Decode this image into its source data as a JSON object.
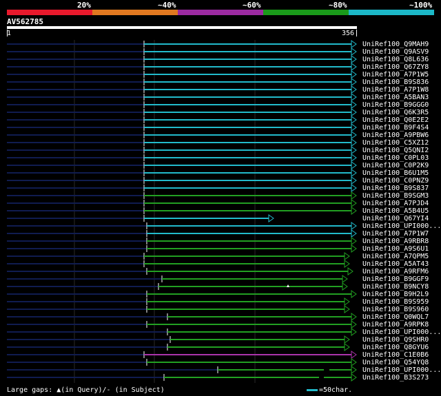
{
  "legend": [
    {
      "label": "20%",
      "color": "#e8192c"
    },
    {
      "label": "~40%",
      "color": "#e07820"
    },
    {
      "label": "~60%",
      "color": "#9b2aa0"
    },
    {
      "label": "~80%",
      "color": "#1a9a1a"
    },
    {
      "label": "~100%",
      "color": "#1cb8c8"
    }
  ],
  "query": {
    "id": "AV562785",
    "start": "1",
    "end": "356"
  },
  "colors": {
    "cyan": "#22bbcc",
    "green": "#22a022",
    "purple": "#aa33aa",
    "navy": "#101c50",
    "gapline": "#2a2a2a"
  },
  "hits": [
    {
      "name": "UniRef100_Q9MAH9",
      "start": 209,
      "end": 510,
      "color": "cyan",
      "arrow": true
    },
    {
      "name": "UniRef100_Q9ASV9",
      "start": 209,
      "end": 510,
      "color": "cyan",
      "arrow": true
    },
    {
      "name": "UniRef100_Q8L636",
      "start": 209,
      "end": 510,
      "color": "cyan",
      "arrow": true
    },
    {
      "name": "UniRef100_Q67ZY8",
      "start": 209,
      "end": 510,
      "color": "cyan",
      "arrow": true
    },
    {
      "name": "UniRef100_A7P1W5",
      "start": 209,
      "end": 510,
      "color": "cyan",
      "arrow": true
    },
    {
      "name": "UniRef100_B9S836",
      "start": 209,
      "end": 510,
      "color": "cyan",
      "arrow": true
    },
    {
      "name": "UniRef100_A7P1W8",
      "start": 209,
      "end": 510,
      "color": "cyan",
      "arrow": true
    },
    {
      "name": "UniRef100_A5BAN3",
      "start": 209,
      "end": 510,
      "color": "cyan",
      "arrow": true
    },
    {
      "name": "UniRef100_B9GGG0",
      "start": 209,
      "end": 510,
      "color": "cyan",
      "arrow": true
    },
    {
      "name": "UniRef100_Q6K3R5",
      "start": 209,
      "end": 510,
      "color": "cyan",
      "arrow": true
    },
    {
      "name": "UniRef100_Q0E2E2",
      "start": 209,
      "end": 510,
      "color": "cyan",
      "arrow": true
    },
    {
      "name": "UniRef100_B9F4S4",
      "start": 209,
      "end": 510,
      "color": "cyan",
      "arrow": true
    },
    {
      "name": "UniRef100_A9PBW6",
      "start": 209,
      "end": 510,
      "color": "cyan",
      "arrow": true
    },
    {
      "name": "UniRef100_C5XZ12",
      "start": 209,
      "end": 510,
      "color": "cyan",
      "arrow": true
    },
    {
      "name": "UniRef100_Q5QNI2",
      "start": 209,
      "end": 510,
      "color": "cyan",
      "arrow": true
    },
    {
      "name": "UniRef100_C0PL03",
      "start": 209,
      "end": 510,
      "color": "cyan",
      "arrow": true
    },
    {
      "name": "UniRef100_C0P2K9",
      "start": 209,
      "end": 510,
      "color": "cyan",
      "arrow": true
    },
    {
      "name": "UniRef100_B6U1M5",
      "start": 209,
      "end": 510,
      "color": "cyan",
      "arrow": true
    },
    {
      "name": "UniRef100_C0PNZ9",
      "start": 209,
      "end": 510,
      "color": "cyan",
      "arrow": true
    },
    {
      "name": "UniRef100_B9S837",
      "start": 209,
      "end": 510,
      "color": "cyan",
      "arrow": true
    },
    {
      "name": "UniRef100_B9SGM3",
      "start": 209,
      "end": 510,
      "color": "green",
      "arrow": true
    },
    {
      "name": "UniRef100_A7PJD4",
      "start": 209,
      "end": 510,
      "color": "green",
      "arrow": true
    },
    {
      "name": "UniRef100_A5B4U5",
      "start": 209,
      "end": 510,
      "color": "green",
      "arrow": true
    },
    {
      "name": "UniRef100_Q67YI4",
      "start": 209,
      "end": 390,
      "color": "cyan",
      "arrow": true
    },
    {
      "name": "UniRef100_UPI000...",
      "start": 213,
      "end": 510,
      "color": "cyan",
      "arrow": true
    },
    {
      "name": "UniRef100_A7P1W7",
      "start": 213,
      "end": 510,
      "color": "cyan",
      "arrow": true
    },
    {
      "name": "UniRef100_A9RBR8",
      "start": 213,
      "end": 510,
      "color": "green",
      "arrow": true
    },
    {
      "name": "UniRef100_A9S6U1",
      "start": 213,
      "end": 510,
      "color": "green",
      "arrow": true
    },
    {
      "name": "UniRef100_A7QPM5",
      "start": 209,
      "end": 500,
      "color": "green",
      "arrow": true
    },
    {
      "name": "UniRef100_A5AT43",
      "start": 209,
      "end": 500,
      "color": "green",
      "arrow": true
    },
    {
      "name": "UniRef100_A9RFM6",
      "start": 213,
      "end": 505,
      "color": "green",
      "arrow": true
    },
    {
      "name": "UniRef100_B9GGF9",
      "start": 235,
      "end": 497,
      "color": "green",
      "arrow": true
    },
    {
      "name": "UniRef100_B9NCY8",
      "start": 230,
      "end": 497,
      "color": "green",
      "arrow": true,
      "queryGapMark": 418
    },
    {
      "name": "UniRef100_B9H2L9",
      "start": 213,
      "end": 510,
      "color": "green",
      "arrow": true
    },
    {
      "name": "UniRef100_B9S959",
      "start": 213,
      "end": 500,
      "color": "green",
      "arrow": true
    },
    {
      "name": "UniRef100_B9S960",
      "start": 213,
      "end": 500,
      "color": "green",
      "arrow": true
    },
    {
      "name": "UniRef100_Q0WQL7",
      "start": 243,
      "end": 510,
      "color": "green",
      "arrow": true
    },
    {
      "name": "UniRef100_A9RPK8",
      "start": 213,
      "end": 510,
      "color": "green",
      "arrow": true
    },
    {
      "name": "UniRef100_UPI000...",
      "start": 243,
      "end": 510,
      "color": "green",
      "arrow": true
    },
    {
      "name": "UniRef100_Q9SHR0",
      "start": 247,
      "end": 500,
      "color": "green",
      "arrow": true
    },
    {
      "name": "UniRef100_Q8GYU6",
      "start": 243,
      "end": 500,
      "color": "green",
      "arrow": true
    },
    {
      "name": "UniRef100_C1E0B6",
      "start": 209,
      "end": 510,
      "color": "purple",
      "arrow": true
    },
    {
      "name": "UniRef100_Q54YQ8",
      "start": 213,
      "end": 510,
      "color": "green",
      "arrow": true
    },
    {
      "name": "UniRef100_UPI000...",
      "start": 316,
      "end": 510,
      "color": "green",
      "arrow": true,
      "subjectGap": [
        470,
        478
      ]
    },
    {
      "name": "UniRef100_B3S273",
      "start": 238,
      "end": 510,
      "color": "green",
      "arrow": true,
      "subjectGap": [
        463,
        470
      ]
    }
  ],
  "footer": {
    "large_gaps": "Large gaps:",
    "query_mark": "▲",
    "in_query": "(in Query)/",
    "subject_mark": "-",
    "in_subject": " (in Subject)",
    "scale_text": "=50char."
  }
}
